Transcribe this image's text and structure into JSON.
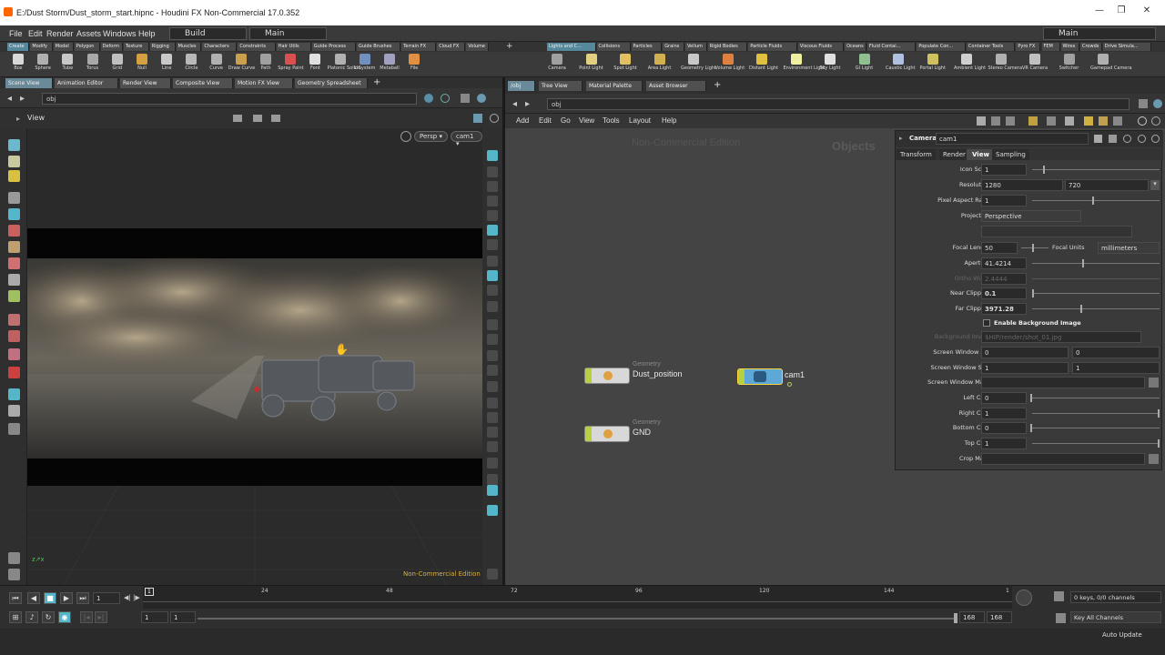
{
  "window": {
    "title": "E:/Dust Storm/Dust_storm_start.hipnc - Houdini FX Non-Commercial 17.0.352",
    "min": "—",
    "max": "❐",
    "close": "✕"
  },
  "menubar": {
    "items": [
      "File",
      "Edit",
      "Render",
      "Assets",
      "Windows",
      "Help"
    ],
    "build_label": "Build",
    "desktop_label": "Main",
    "right_desktop_label": "Main"
  },
  "shelf_tabs_left": [
    "Create",
    "Modify",
    "Model",
    "Polygon",
    "Deform",
    "Texture",
    "Rigging",
    "Muscles",
    "Characters",
    "Constraints",
    "Hair Utils",
    "Guide Process",
    "Guide Brushes",
    "Terrain FX",
    "Cloud FX",
    "Volume"
  ],
  "shelf_tabs_right": [
    "Lights and C...",
    "Collisions",
    "Particles",
    "Grains",
    "Vellum",
    "Rigid Bodies",
    "Particle Fluids",
    "Viscous Fluids",
    "Oceans",
    "Fluid Contai...",
    "Populate Con...",
    "Container Tools",
    "Pyro FX",
    "FEM",
    "Wires",
    "Crowds",
    "Drive Simula..."
  ],
  "shelf_tools_left": [
    "Box",
    "Sphere",
    "Tube",
    "Torus",
    "Grid",
    "Null",
    "Line",
    "Circle",
    "Curve",
    "Draw Curve",
    "Path",
    "Spray Paint",
    "Font",
    "Platonic Solids",
    "L-System",
    "Metaball",
    "File"
  ],
  "shelf_tools_right": [
    "Camera",
    "Point Light",
    "Spot Light",
    "Area Light",
    "Geometry Light",
    "Volume Light",
    "Distant Light",
    "Environment Light",
    "Sky Light",
    "GI Light",
    "Caustic Light",
    "Portal Light",
    "Ambient Light",
    "Stereo Camera",
    "VR Camera",
    "Switcher",
    "Gamepad Camera"
  ],
  "left_pane_tabs": [
    "Scene View",
    "Animation Editor",
    "Render View",
    "Composite View",
    "Motion FX View",
    "Geometry Spreadsheet"
  ],
  "right_pane_tabs": [
    "/obj",
    "Tree View",
    "Material Palette",
    "Asset Browser"
  ],
  "viewport": {
    "path": "obj",
    "label": "View",
    "persp": "Persp ▾",
    "cam": "cam1 ▾",
    "watermark": "Non-Commercial Edition"
  },
  "network": {
    "path": "obj",
    "menu": [
      "Add",
      "Edit",
      "Go",
      "View",
      "Tools",
      "Layout",
      "Help"
    ],
    "watermark": "Non-Commercial Edition",
    "context": "Objects",
    "nodes": [
      {
        "type": "Geometry",
        "name": "Dust_position"
      },
      {
        "type": "Geometry",
        "name": "GND"
      },
      {
        "type": "",
        "name": "cam1"
      }
    ]
  },
  "params": {
    "node_type": "Camera",
    "node_name": "cam1",
    "tabs": [
      "Transform",
      "Render",
      "View",
      "Sampling"
    ],
    "icon_scale": {
      "label": "Icon Scale",
      "value": "1"
    },
    "resolution": {
      "label": "Resolution",
      "x": "1280",
      "y": "720"
    },
    "pixel_aspect": {
      "label": "Pixel Aspect Ratio",
      "value": "1"
    },
    "projection": {
      "label": "Projection",
      "value": "Perspective"
    },
    "focal_length": {
      "label": "Focal Length",
      "value": "50",
      "units_label": "Focal Units",
      "units": "millimeters"
    },
    "aperture": {
      "label": "Aperture",
      "value": "41.4214"
    },
    "ortho_width": {
      "label": "Ortho Width",
      "value": "2.4444"
    },
    "near_clip": {
      "label": "Near Clipping",
      "value": "0.1"
    },
    "far_clip": {
      "label": "Far Clipping",
      "value": "3971.28"
    },
    "enable_bg": "Enable Background Image",
    "bg_image": {
      "label": "Background Image",
      "value": "$HIP/render/shot_01.jpg"
    },
    "screen_window_xy": {
      "label": "Screen Window X/Y",
      "x": "0",
      "y": "0"
    },
    "screen_window_size": {
      "label": "Screen Window Size",
      "x": "1",
      "y": "1"
    },
    "screen_window_mask": {
      "label": "Screen Window Mask",
      "value": ""
    },
    "left_crop": {
      "label": "Left Crop",
      "value": "0"
    },
    "right_crop": {
      "label": "Right Crop",
      "value": "1"
    },
    "bottom_crop": {
      "label": "Bottom Crop",
      "value": "0"
    },
    "top_crop": {
      "label": "Top Crop",
      "value": "1"
    },
    "crop_mask": {
      "label": "Crop Mask",
      "value": ""
    }
  },
  "timeline": {
    "frame": "1",
    "ticks": [
      "24",
      "48",
      "72",
      "96",
      "120",
      "144",
      "1"
    ],
    "start": "1",
    "start2": "1",
    "end": "168",
    "end2": "168",
    "keys_info": "0 keys, 0/0 channels",
    "key_all": "Key All Channels",
    "auto_update": "Auto Update",
    "current_marker": "1"
  }
}
